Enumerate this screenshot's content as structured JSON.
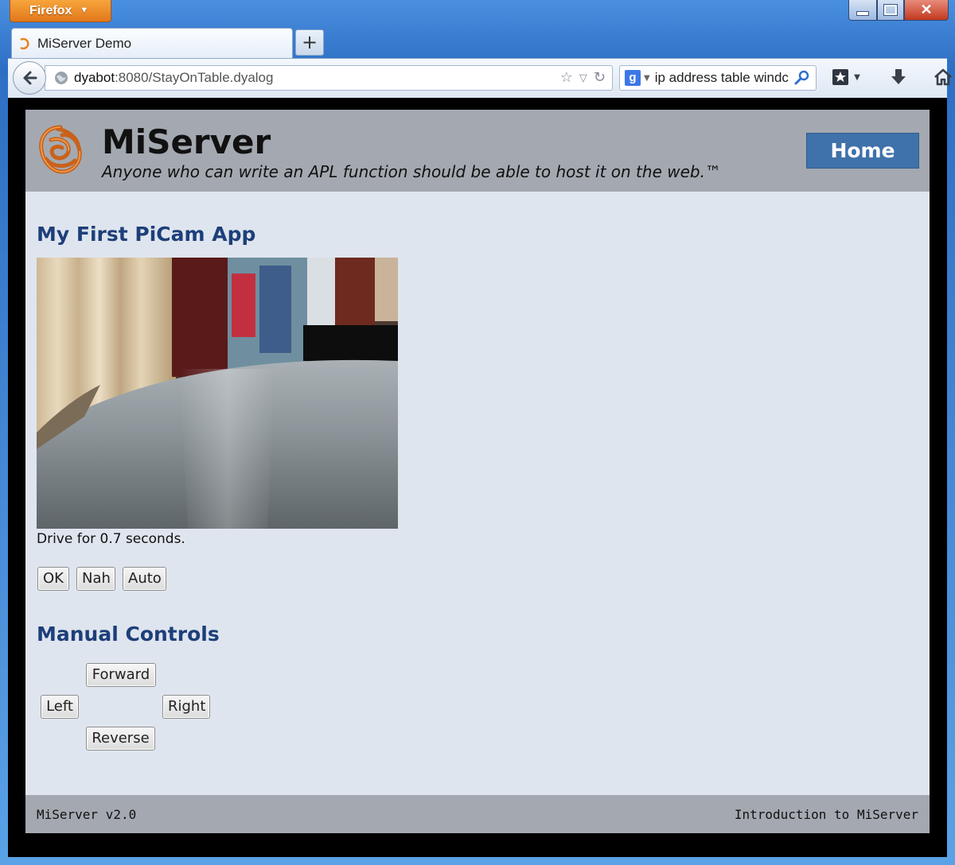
{
  "browser": {
    "app_menu_label": "Firefox",
    "tab_title": "MiServer Demo",
    "url_host": "dyabot",
    "url_rest": ":8080/StayOnTable.dyalog",
    "search_query": "ip address table windc",
    "colors": {
      "firefox_orange": "#e8831f",
      "frame_blue": "#2d6fc4"
    }
  },
  "site": {
    "title": "MiServer",
    "tagline": "Anyone who can write an APL function should be able to host it on the web.™",
    "home_label": "Home",
    "colors": {
      "header_bg": "#a4a9b1",
      "page_bg": "#dfe5ee",
      "heading_blue": "#1d3f7a",
      "home_btn": "#3f72aa"
    }
  },
  "picam": {
    "heading": "My First PiCam App",
    "drive_text": "Drive for 0.7 seconds.",
    "buttons": {
      "ok": "OK",
      "nah": "Nah",
      "auto": "Auto"
    }
  },
  "manual": {
    "heading": "Manual Controls",
    "forward": "Forward",
    "left": "Left",
    "right": "Right",
    "reverse": "Reverse"
  },
  "footer": {
    "version": "MiServer v2.0",
    "link": "Introduction to MiServer"
  }
}
